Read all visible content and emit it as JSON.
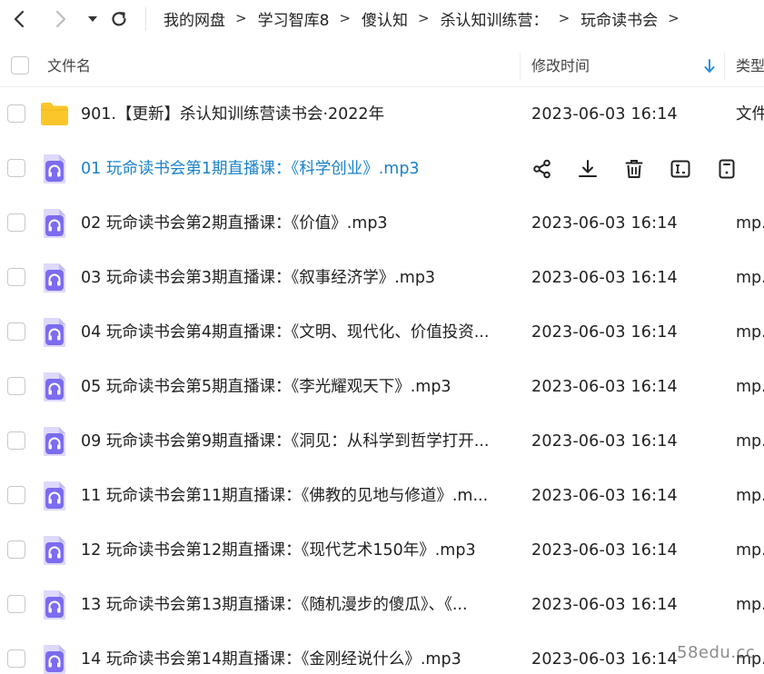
{
  "nav": {
    "back_icon": "chevron-left-icon",
    "forward_icon": "chevron-right-icon",
    "dropdown_icon": "caret-down-icon",
    "refresh_icon": "refresh-icon"
  },
  "breadcrumb": [
    {
      "label": "我的网盘"
    },
    {
      "label": "学习智库8"
    },
    {
      "label": "傻认知"
    },
    {
      "label": "杀认知训练营："
    },
    {
      "label": "玩命读书会"
    }
  ],
  "breadcrumb_separator": ">",
  "columns": {
    "name": "文件名",
    "modified": "修改时间",
    "type": "类型"
  },
  "colors": {
    "accent": "#1a82c9",
    "folder": "#fbc629",
    "audio_icon": "#7b6cf0"
  },
  "files": [
    {
      "name": "901.【更新】杀认知训练营读书会·2022年",
      "time": "2023-06-03 16:14",
      "type": "文件",
      "icon": "folder-icon"
    },
    {
      "name": "01 玩命读书会第1期直播课：《科学创业》.mp3",
      "time": "",
      "type": "",
      "icon": "audio-file-icon",
      "hovered": true
    },
    {
      "name": "02 玩命读书会第2期直播课：《价值》.mp3",
      "time": "2023-06-03 16:14",
      "type": "mp.",
      "icon": "audio-file-icon"
    },
    {
      "name": "03 玩命读书会第3期直播课：《叙事经济学》.mp3",
      "time": "2023-06-03 16:14",
      "type": "mp.",
      "icon": "audio-file-icon"
    },
    {
      "name": "04 玩命读书会第4期直播课：《文明、现代化、价值投资...",
      "time": "2023-06-03 16:14",
      "type": "mp.",
      "icon": "audio-file-icon"
    },
    {
      "name": "05 玩命读书会第5期直播课：《李光耀观天下》.mp3",
      "time": "2023-06-03 16:14",
      "type": "mp.",
      "icon": "audio-file-icon"
    },
    {
      "name": "09 玩命读书会第9期直播课：《洞见：从科学到哲学打开...",
      "time": "2023-06-03 16:14",
      "type": "mp.",
      "icon": "audio-file-icon"
    },
    {
      "name": "11 玩命读书会第11期直播课：《佛教的见地与修道》.m...",
      "time": "2023-06-03 16:14",
      "type": "mp.",
      "icon": "audio-file-icon"
    },
    {
      "name": "12 玩命读书会第12期直播课：《现代艺术150年》.mp3",
      "time": "2023-06-03 16:14",
      "type": "mp.",
      "icon": "audio-file-icon"
    },
    {
      "name": "13 玩命读书会第13期直播课：《随机漫步的傻瓜》、《...",
      "time": "2023-06-03 16:14",
      "type": "mp.",
      "icon": "audio-file-icon"
    },
    {
      "name": "14 玩命读书会第14期直播课：《金刚经说什么》.mp3",
      "time": "2023-06-03 16:14",
      "type": "mp.",
      "icon": "audio-file-icon"
    }
  ],
  "hover_actions": [
    {
      "icon": "share-icon"
    },
    {
      "icon": "download-icon"
    },
    {
      "icon": "delete-icon"
    },
    {
      "icon": "rename-icon"
    },
    {
      "icon": "more-icon"
    }
  ],
  "watermark": "58edu.cc"
}
